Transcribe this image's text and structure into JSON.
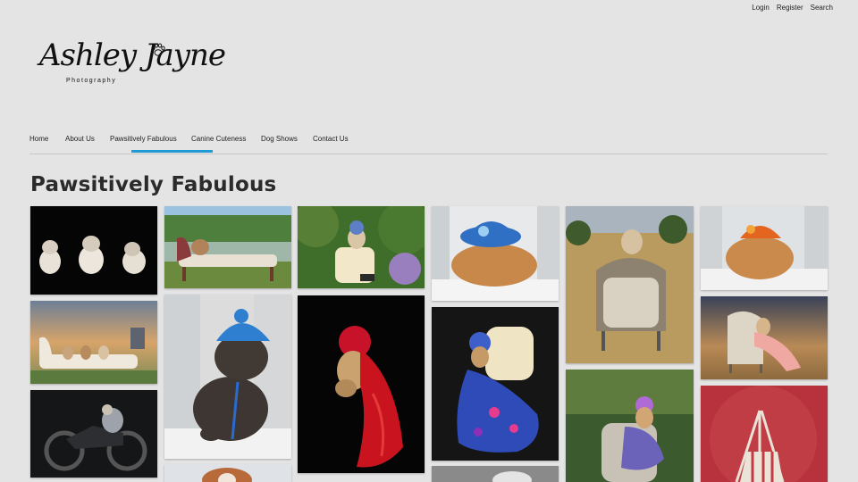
{
  "header": {
    "links": [
      {
        "id": "login",
        "label": "Login"
      },
      {
        "id": "register",
        "label": "Register"
      },
      {
        "id": "search",
        "label": "Search"
      }
    ]
  },
  "logo": {
    "name": "Ashley Jayne",
    "tagline": "Photography",
    "icon": "paw-icon"
  },
  "nav": {
    "items": [
      {
        "label": "Home"
      },
      {
        "label": "About Us"
      },
      {
        "label": "Pawsitively Fabulous",
        "active": true
      },
      {
        "label": "Canine Cuteness"
      },
      {
        "label": "Dog Shows"
      },
      {
        "label": "Contact Us"
      }
    ],
    "accent_color": "#1e9ad6"
  },
  "page": {
    "title": "Pawsitively Fabulous"
  },
  "gallery": {
    "photos": [
      {
        "id": "three-bulldogs-black"
      },
      {
        "id": "bulldog-chaise-lake"
      },
      {
        "id": "chihuahua-armchair-garden"
      },
      {
        "id": "pomeranian-blue-hat"
      },
      {
        "id": "chihuahua-armchair-field"
      },
      {
        "id": "pomeranian-orange-hat"
      },
      {
        "id": "dogs-chaise-sunset-castle"
      },
      {
        "id": "frenchie-blue-beanie"
      },
      {
        "id": "chihuahua-red-gown"
      },
      {
        "id": "chihuahua-blue-gown"
      },
      {
        "id": "chihuahua-chair-sunset"
      },
      {
        "id": "dog-motorcycle"
      },
      {
        "id": "chihuahua-sequin-dress"
      },
      {
        "id": "red-backdrop-teepee"
      },
      {
        "id": "puppy-partial"
      },
      {
        "id": "dog-partial-gray"
      }
    ]
  }
}
